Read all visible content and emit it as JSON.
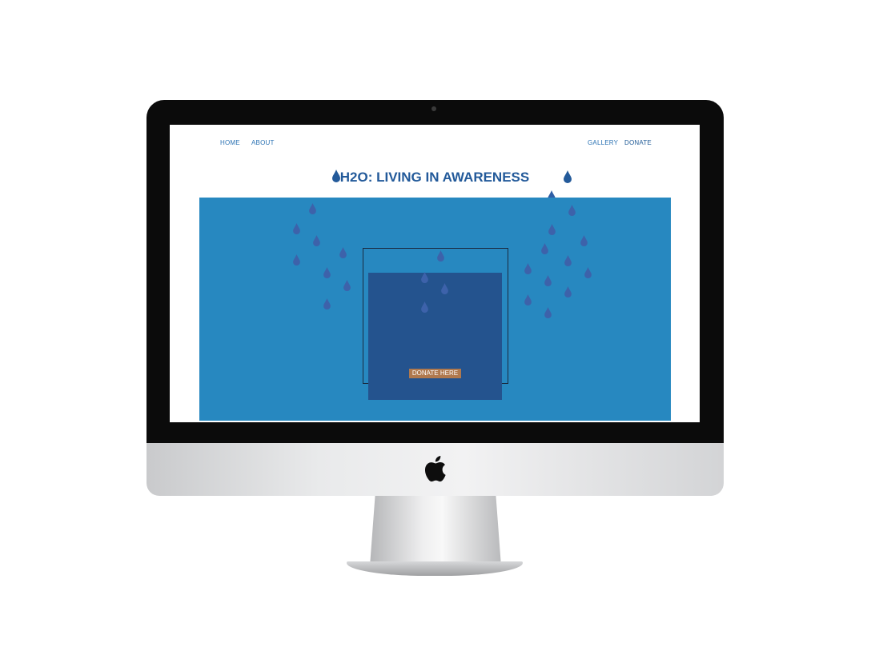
{
  "site": {
    "title": "H2O: LIVING IN AWARENESS",
    "nav_left": [
      {
        "label": "HOME"
      },
      {
        "label": "ABOUT"
      }
    ],
    "nav_right": [
      {
        "label": "GALLERY"
      },
      {
        "label": "DONATE"
      }
    ],
    "hero": {
      "donate_button": "DONATE HERE"
    }
  },
  "colors": {
    "nav_text": "#2b72b3",
    "title": "#235a9a",
    "hero_bg": "#2788c0",
    "panel_bg": "#24538e",
    "button_bg": "#b0794e",
    "drop": "#3d62aa"
  },
  "icons": {
    "drop": "water-drop-icon",
    "logo": "apple-logo-icon"
  }
}
